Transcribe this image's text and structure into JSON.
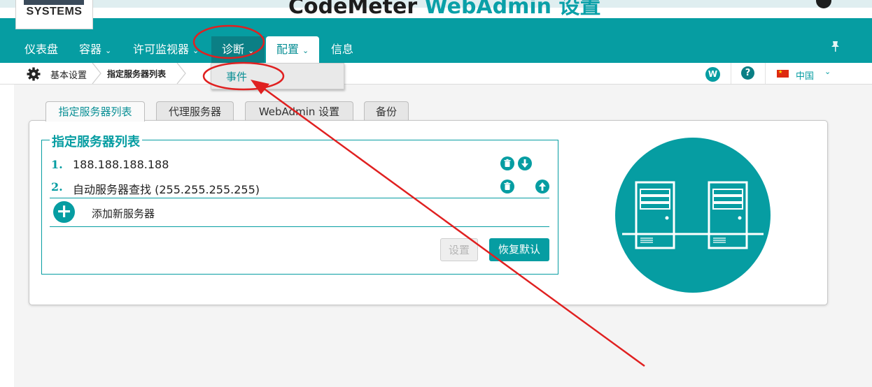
{
  "logo": {
    "text": "SYSTEMS"
  },
  "title": {
    "main": "CodeMeter",
    "accent": "WebAdmin 设置"
  },
  "nav": {
    "items": [
      {
        "label": "仪表盘"
      },
      {
        "label": "容器"
      },
      {
        "label": "许可监视器"
      },
      {
        "label": "诊断"
      },
      {
        "label": "配置"
      },
      {
        "label": "信息"
      }
    ],
    "chevron": "⌄"
  },
  "dropdown": {
    "items": [
      {
        "label": "事件"
      }
    ]
  },
  "breadcrumb": {
    "items": [
      "基本设置",
      "指定服务器列表"
    ]
  },
  "header_right": {
    "w_label": "W",
    "help_label": "?",
    "language": "中国",
    "flag_star": "★"
  },
  "tabs": [
    {
      "label": "指定服务器列表",
      "active": true
    },
    {
      "label": "代理服务器",
      "active": false
    },
    {
      "label": "WebAdmin 设置",
      "active": false
    },
    {
      "label": "备份",
      "active": false
    }
  ],
  "server_list": {
    "legend": "指定服务器列表",
    "rows": [
      {
        "num": "1.",
        "text": "188.188.188.188"
      },
      {
        "num": "2.",
        "text": "自动服务器查找 (255.255.255.255)"
      }
    ],
    "add_label": "添加新服务器",
    "add_symbol": "+"
  },
  "buttons": {
    "settings": "设置",
    "restore": "恢复默认"
  },
  "colors": {
    "brand": "#069da2",
    "annotation": "#e02020"
  }
}
